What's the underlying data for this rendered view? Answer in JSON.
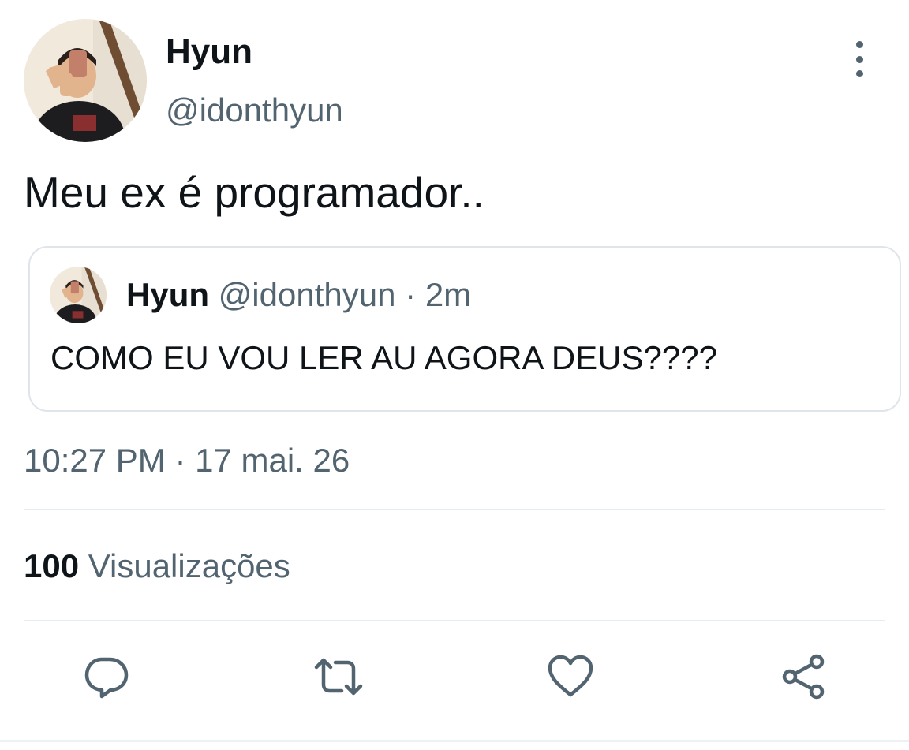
{
  "author": {
    "display_name": "Hyun",
    "handle": "@idonthyun"
  },
  "tweet": {
    "text": "Meu ex é programador..",
    "timestamp": "10:27 PM · 17 mai. 26",
    "views_count": "100",
    "views_label": "Visualizações"
  },
  "quoted": {
    "display_name": "Hyun",
    "handle": "@idonthyun",
    "separator": "·",
    "time": "2m",
    "text": "COMO EU VOU LER AU AGORA DEUS????"
  },
  "icons": {
    "more": "more-vertical-icon",
    "reply": "reply-bubble-icon",
    "retweet": "retweet-icon",
    "like": "heart-icon",
    "share": "share-icon"
  },
  "colors": {
    "text_primary": "#0f1419",
    "text_secondary": "#536471",
    "border": "#dfe5ea"
  }
}
